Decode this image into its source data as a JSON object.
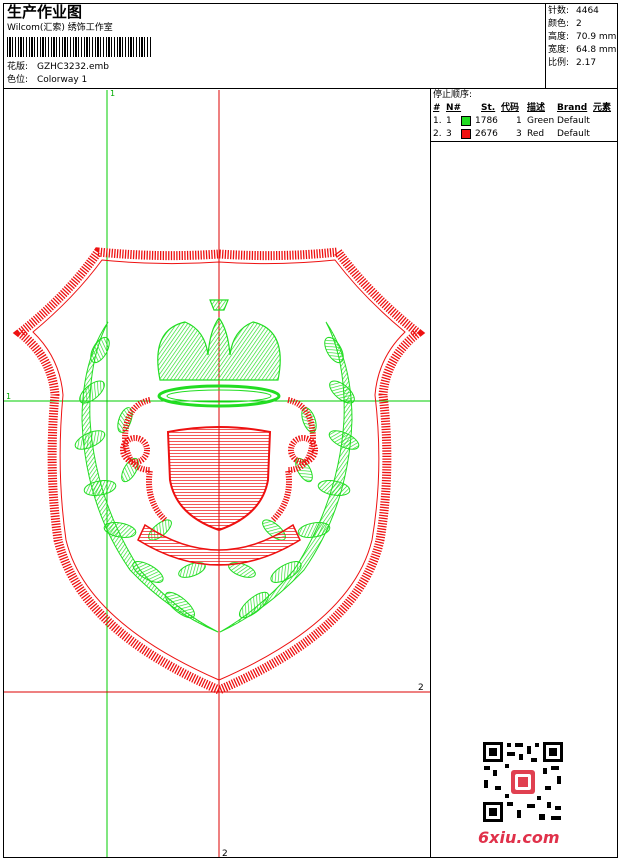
{
  "header": {
    "title": "生产作业图",
    "company": "Wilcom(汇索) 绣饰工作室",
    "design_label": "花版:",
    "design_value": "GZHC3232.emb",
    "colorway_label": "色位:",
    "colorway_value": "Colorway 1"
  },
  "stats": [
    {
      "label": "针数:",
      "value": "4464"
    },
    {
      "label": "颜色:",
      "value": "2"
    },
    {
      "label": "高度:",
      "value": "70.9 mm"
    },
    {
      "label": "宽度:",
      "value": "64.8 mm"
    },
    {
      "label": "比例:",
      "value": "2.17"
    }
  ],
  "stop_sequence": {
    "title": "停止顺序:",
    "headers": [
      "#",
      "N#",
      "St.",
      "代码",
      "描述",
      "Brand",
      "元素"
    ],
    "rows": [
      {
        "num": "1.",
        "n": "1",
        "stitches": "1786",
        "code": "1",
        "desc": "Green",
        "brand": "Default",
        "color": "#22dd22"
      },
      {
        "num": "2.",
        "n": "3",
        "stitches": "2676",
        "code": "3",
        "desc": "Red",
        "brand": "Default",
        "color": "#ee1111"
      }
    ]
  },
  "axes": {
    "v1": "1",
    "h1": "1",
    "h2": "2",
    "v2": "2"
  },
  "colors": {
    "green": "#22dd22",
    "red": "#ee1111",
    "guide_green": "#00cc00",
    "guide_red": "#dd0000"
  },
  "watermark": "6xiu.com"
}
